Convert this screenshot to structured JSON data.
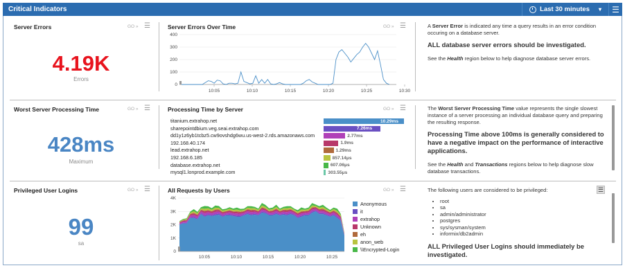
{
  "header": {
    "title": "Critical Indicators",
    "time_range": "Last 30 minutes",
    "caret": "▾",
    "menu_glyph": "☰"
  },
  "go": "GO »",
  "hamburger": "☰",
  "row1": {
    "metric_title": "Server Errors",
    "value": "4.19K",
    "value_color": "#e8141e",
    "sublabel": "Errors",
    "chart_title": "Server Errors Over Time",
    "info": {
      "p1_a": "A ",
      "p1_b": "Server Error",
      "p1_c": " is indicated any time a query results in an error condition occuring on a database server.",
      "big": "ALL database server errors should be investigated.",
      "p2_a": "See the ",
      "p2_b": "Health",
      "p2_c": " region below to help diagnose database server errors."
    }
  },
  "row2": {
    "metric_title": "Worst Server Processing Time",
    "value": "428ms",
    "value_color": "#4a86c4",
    "sublabel": "Maximum",
    "chart_title": "Processing Time by Server",
    "servers": [
      {
        "name": "titanium.extrahop.net",
        "value": "10.29ms",
        "ms": 10.29,
        "color": "#4a8fc8"
      },
      {
        "name": "sharepointdbium.veg.seai.extrahop.com",
        "value": "7.26ms",
        "ms": 7.26,
        "color": "#6a4fc2"
      },
      {
        "name": "dd1y1z6yb1tcbz5.cw9ovshdg6wu.us-west-2.rds.amazonaws.com",
        "value": "2.77ms",
        "ms": 2.77,
        "color": "#b040b8"
      },
      {
        "name": "192.168.40.174",
        "value": "1.9ms",
        "ms": 1.9,
        "color": "#b8386a"
      },
      {
        "name": "lead.extrahop.net",
        "value": "1.29ms",
        "ms": 1.29,
        "color": "#b06a3c"
      },
      {
        "name": "192.168.6.185",
        "value": "857.14μs",
        "ms": 0.857,
        "color": "#b8c440"
      },
      {
        "name": "database.extrahop.net",
        "value": "607.06μs",
        "ms": 0.607,
        "color": "#48b848"
      },
      {
        "name": "mysql1.lonprod.example.com",
        "value": "303.55μs",
        "ms": 0.303,
        "color": "#6cc8a8"
      }
    ],
    "info": {
      "p1_a": "The ",
      "p1_b": "Worst Server Processing Time",
      "p1_c": " value represents the single slowest instance of a server processing an individual database query and preparing the resulting response.",
      "big": "Processing Time above 100ms is generally considered to have a negative impact on the performance of interactive applications.",
      "p2_a": "See the ",
      "p2_b": "Health",
      "p2_c": " and ",
      "p2_d": "Transactions",
      "p2_e": " regions below to help diagnose slow database transactions."
    }
  },
  "row3": {
    "metric_title": "Privileged User Logins",
    "value": "99",
    "value_color": "#4a86c4",
    "sublabel": "sa",
    "chart_title": "All Requests by Users",
    "info": {
      "p1": "The following users are considered to be privileged:",
      "users": [
        "root",
        "sa",
        "admin/administrator",
        "postgres",
        "sys/sysman/system",
        "informix/db2admin"
      ],
      "big": "ALL Privileged User Logins should immediately be investigated."
    }
  },
  "chart_data": [
    {
      "type": "line",
      "title": "Server Errors Over Time",
      "x_ticks": [
        "10:05",
        "10:10",
        "10:15",
        "10:20",
        "10:25",
        "10:30"
      ],
      "y_ticks": [
        "0",
        "100",
        "200",
        "300",
        "400"
      ],
      "ylim": [
        0,
        400
      ],
      "color": "#4a8fc8",
      "series": [
        {
          "values": [
            0,
            0,
            0,
            0,
            0,
            0,
            0,
            0,
            15,
            30,
            25,
            10,
            35,
            30,
            5,
            0,
            10,
            10,
            5,
            10,
            100,
            25,
            15,
            5,
            10,
            70,
            10,
            40,
            10,
            40,
            5,
            0,
            5,
            15,
            5,
            0,
            0,
            0,
            0,
            0,
            0,
            10,
            30,
            40,
            20,
            10,
            0,
            0,
            0,
            0,
            0,
            10,
            200,
            260,
            280,
            250,
            220,
            180,
            210,
            240,
            260,
            300,
            330,
            300,
            250,
            200,
            270,
            160,
            40,
            10,
            0
          ]
        }
      ]
    },
    {
      "type": "bar",
      "title": "Processing Time by Server",
      "categories": [
        "titanium.extrahop.net",
        "sharepointdbium.veg.seai.extrahop.com",
        "dd1y1z6yb1tcbz5.cw9ovshdg6wu.us-west-2.rds.amazonaws.com",
        "192.168.40.174",
        "lead.extrahop.net",
        "192.168.6.185",
        "database.extrahop.net",
        "mysql1.lonprod.example.com"
      ],
      "values": [
        10.29,
        7.26,
        2.77,
        1.9,
        1.29,
        0.857,
        0.607,
        0.304
      ]
    },
    {
      "type": "area",
      "title": "All Requests by Users",
      "x_ticks": [
        "10:05",
        "10:10",
        "10:15",
        "10:20",
        "10:25",
        "10:30"
      ],
      "y_ticks": [
        "0",
        "1K",
        "2K",
        "3K",
        "4K"
      ],
      "ylim": [
        0,
        4000
      ],
      "legend": [
        "Anonymous",
        "it",
        "extrahop",
        "Unknown",
        "eh",
        "anon_web",
        "\\\\Encrypted-Login"
      ],
      "series": [
        {
          "name": "Anonymous",
          "color": "#4a8fc8",
          "values": [
            2000,
            2100,
            2100,
            2500,
            2500,
            2400,
            2800,
            2600,
            2700,
            2650,
            2700,
            2750,
            2600,
            2700,
            2700,
            2650,
            2600,
            2600,
            2700,
            2800,
            2700,
            2750,
            2700,
            2900,
            2850,
            2700,
            2700,
            2800,
            2700,
            2750,
            2700,
            2800,
            2700,
            2500,
            2600,
            2700,
            2700,
            2900,
            3000,
            2800,
            2800,
            2700,
            2600,
            2700,
            2500,
            2300,
            1200
          ]
        },
        {
          "name": "it",
          "color": "#6a4fc2",
          "values": [
            30,
            40,
            50,
            60,
            80,
            70,
            60,
            90,
            80,
            70,
            90,
            80,
            70,
            60,
            80,
            70,
            80,
            70,
            60,
            70,
            80,
            70,
            60,
            80,
            70,
            60,
            70,
            80,
            60,
            70,
            80,
            70,
            60,
            70,
            80,
            60,
            70,
            80,
            60,
            70,
            80,
            70,
            60,
            70,
            80,
            60,
            30
          ]
        },
        {
          "name": "extrahop",
          "color": "#b040b8",
          "values": [
            80,
            90,
            100,
            120,
            150,
            140,
            130,
            180,
            160,
            150,
            170,
            160,
            140,
            130,
            150,
            140,
            160,
            150,
            130,
            150,
            160,
            150,
            140,
            160,
            150,
            140,
            150,
            160,
            140,
            150,
            160,
            150,
            140,
            150,
            160,
            140,
            150,
            160,
            140,
            150,
            160,
            150,
            140,
            150,
            160,
            140,
            60
          ]
        },
        {
          "name": "Unknown",
          "color": "#b8386a",
          "values": [
            60,
            70,
            80,
            100,
            120,
            110,
            100,
            130,
            120,
            110,
            130,
            120,
            110,
            100,
            120,
            110,
            120,
            110,
            100,
            110,
            120,
            110,
            100,
            120,
            110,
            100,
            110,
            120,
            100,
            110,
            120,
            110,
            100,
            110,
            120,
            100,
            110,
            120,
            100,
            110,
            120,
            110,
            100,
            110,
            120,
            100,
            40
          ]
        },
        {
          "name": "eh",
          "color": "#b06a3c",
          "values": [
            20,
            30,
            30,
            40,
            50,
            40,
            40,
            50,
            40,
            40,
            50,
            40,
            40,
            30,
            40,
            40,
            50,
            40,
            30,
            40,
            50,
            40,
            30,
            50,
            40,
            30,
            40,
            50,
            30,
            40,
            50,
            40,
            30,
            40,
            50,
            30,
            40,
            50,
            30,
            40,
            50,
            40,
            30,
            40,
            50,
            30,
            10
          ]
        },
        {
          "name": "anon_web",
          "color": "#b8c440",
          "values": [
            40,
            50,
            60,
            80,
            120,
            100,
            90,
            150,
            130,
            110,
            140,
            120,
            100,
            90,
            110,
            100,
            130,
            110,
            90,
            110,
            130,
            110,
            90,
            140,
            120,
            100,
            110,
            130,
            90,
            110,
            130,
            110,
            90,
            110,
            130,
            90,
            110,
            140,
            90,
            110,
            130,
            110,
            90,
            110,
            130,
            90,
            30
          ]
        },
        {
          "name": "\\\\Encrypted-Login",
          "color": "#48b848",
          "values": [
            40,
            50,
            60,
            80,
            150,
            100,
            90,
            200,
            150,
            110,
            160,
            130,
            100,
            90,
            110,
            100,
            150,
            110,
            90,
            110,
            150,
            110,
            90,
            180,
            140,
            100,
            110,
            160,
            90,
            110,
            150,
            110,
            90,
            110,
            160,
            90,
            110,
            170,
            90,
            110,
            150,
            110,
            90,
            110,
            160,
            90,
            30
          ]
        }
      ]
    }
  ]
}
